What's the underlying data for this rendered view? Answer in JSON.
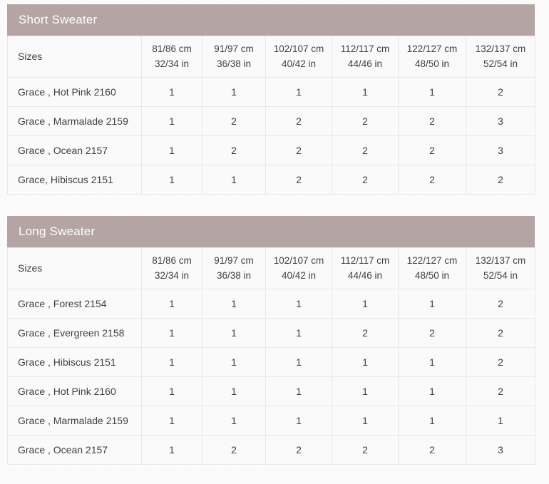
{
  "theme": {
    "caption_background": "#b4a4a4",
    "caption_text": "#ffffff",
    "table_background": "#fbfafa",
    "border": "#e9e7e7",
    "text": "#3f3f43",
    "page_background": "#fcfbfb"
  },
  "tables": [
    {
      "caption": "Short Sweater",
      "label_header": "Sizes",
      "size_columns": [
        {
          "cm": "81/86 cm",
          "in": "32/34 in"
        },
        {
          "cm": "91/97 cm",
          "in": "36/38 in"
        },
        {
          "cm": "102/107 cm",
          "in": "40/42 in"
        },
        {
          "cm": "112/117 cm",
          "in": "44/46 in"
        },
        {
          "cm": "122/127 cm",
          "in": "48/50 in"
        },
        {
          "cm": "132/137 cm",
          "in": "52/54 in"
        }
      ],
      "rows": [
        {
          "label": "Grace , Hot Pink 2160",
          "values": [
            "1",
            "1",
            "1",
            "1",
            "1",
            "2"
          ]
        },
        {
          "label": "Grace , Marmalade 2159",
          "values": [
            "1",
            "2",
            "2",
            "2",
            "2",
            "3"
          ]
        },
        {
          "label": "Grace , Ocean 2157",
          "values": [
            "1",
            "2",
            "2",
            "2",
            "2",
            "3"
          ]
        },
        {
          "label": "Grace, Hibiscus 2151",
          "values": [
            "1",
            "1",
            "2",
            "2",
            "2",
            "2"
          ]
        }
      ]
    },
    {
      "caption": "Long Sweater",
      "label_header": "Sizes",
      "size_columns": [
        {
          "cm": "81/86 cm",
          "in": "32/34 in"
        },
        {
          "cm": "91/97 cm",
          "in": "36/38 in"
        },
        {
          "cm": "102/107 cm",
          "in": "40/42 in"
        },
        {
          "cm": "112/117 cm",
          "in": "44/46 in"
        },
        {
          "cm": "122/127 cm",
          "in": "48/50 in"
        },
        {
          "cm": "132/137 cm",
          "in": "52/54 in"
        }
      ],
      "rows": [
        {
          "label": "Grace , Forest 2154",
          "values": [
            "1",
            "1",
            "1",
            "1",
            "1",
            "2"
          ]
        },
        {
          "label": "Grace , Evergreen 2158",
          "values": [
            "1",
            "1",
            "1",
            "2",
            "2",
            "2"
          ]
        },
        {
          "label": "Grace , Hibiscus 2151",
          "values": [
            "1",
            "1",
            "1",
            "1",
            "1",
            "2"
          ]
        },
        {
          "label": "Grace , Hot Pink 2160",
          "values": [
            "1",
            "1",
            "1",
            "1",
            "1",
            "2"
          ]
        },
        {
          "label": "Grace , Marmalade 2159",
          "values": [
            "1",
            "1",
            "1",
            "1",
            "1",
            "1"
          ]
        },
        {
          "label": "Grace , Ocean 2157",
          "values": [
            "1",
            "2",
            "2",
            "2",
            "2",
            "3"
          ]
        }
      ]
    }
  ]
}
